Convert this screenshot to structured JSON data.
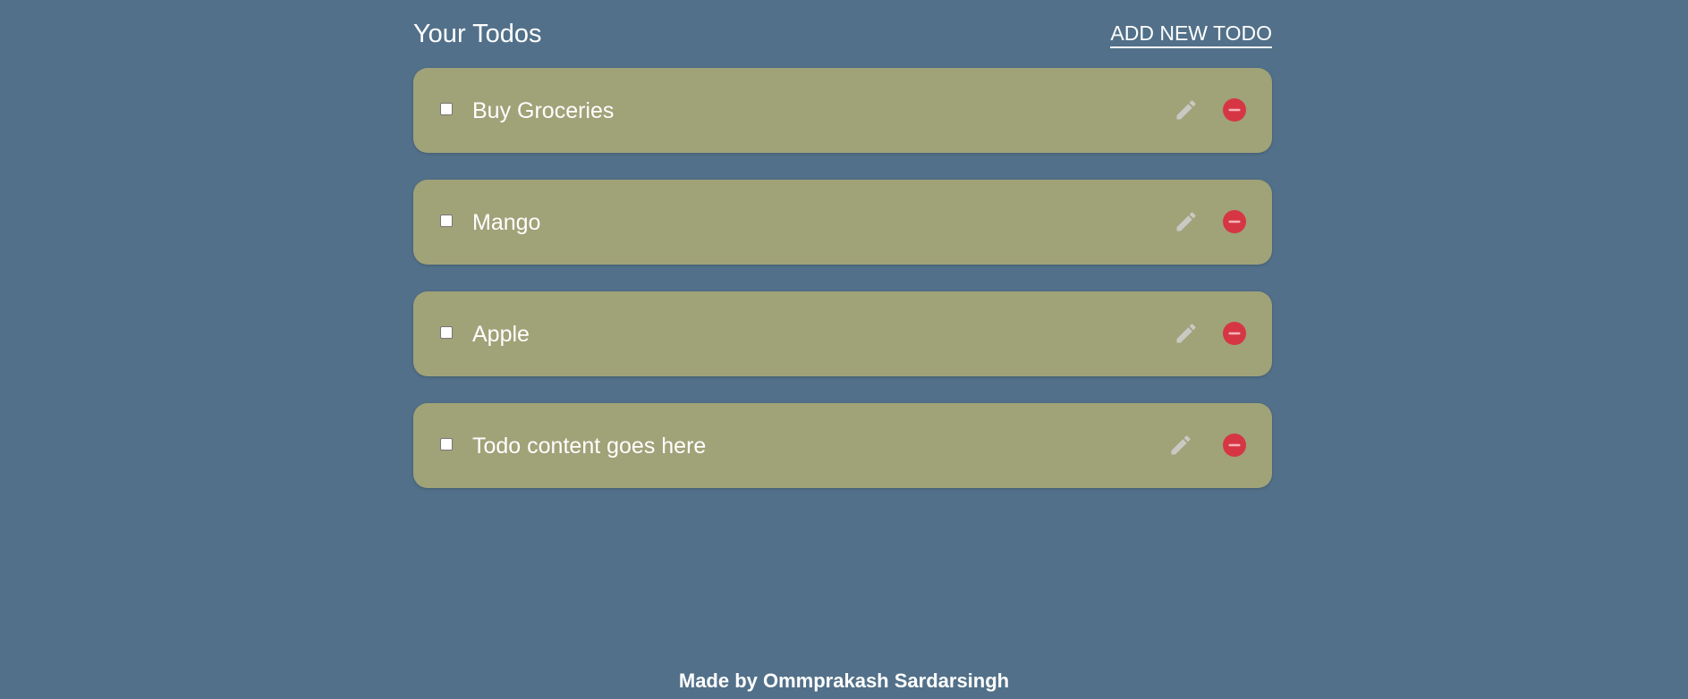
{
  "header": {
    "title": "Your Todos",
    "add_label": "ADD NEW TODO"
  },
  "todos": [
    {
      "text": "Buy Groceries",
      "checked": false
    },
    {
      "text": "Mango",
      "checked": false
    },
    {
      "text": "Apple",
      "checked": false
    },
    {
      "text": "Todo content goes here",
      "checked": false
    }
  ],
  "icons": {
    "edit": "pencil-icon",
    "delete": "minus-circle-icon"
  },
  "colors": {
    "background": "#527089",
    "card": "#a0a278",
    "delete": "#d63644",
    "edit": "#c9c9c4"
  },
  "footer": {
    "text": "Made by Ommprakash Sardarsingh"
  }
}
